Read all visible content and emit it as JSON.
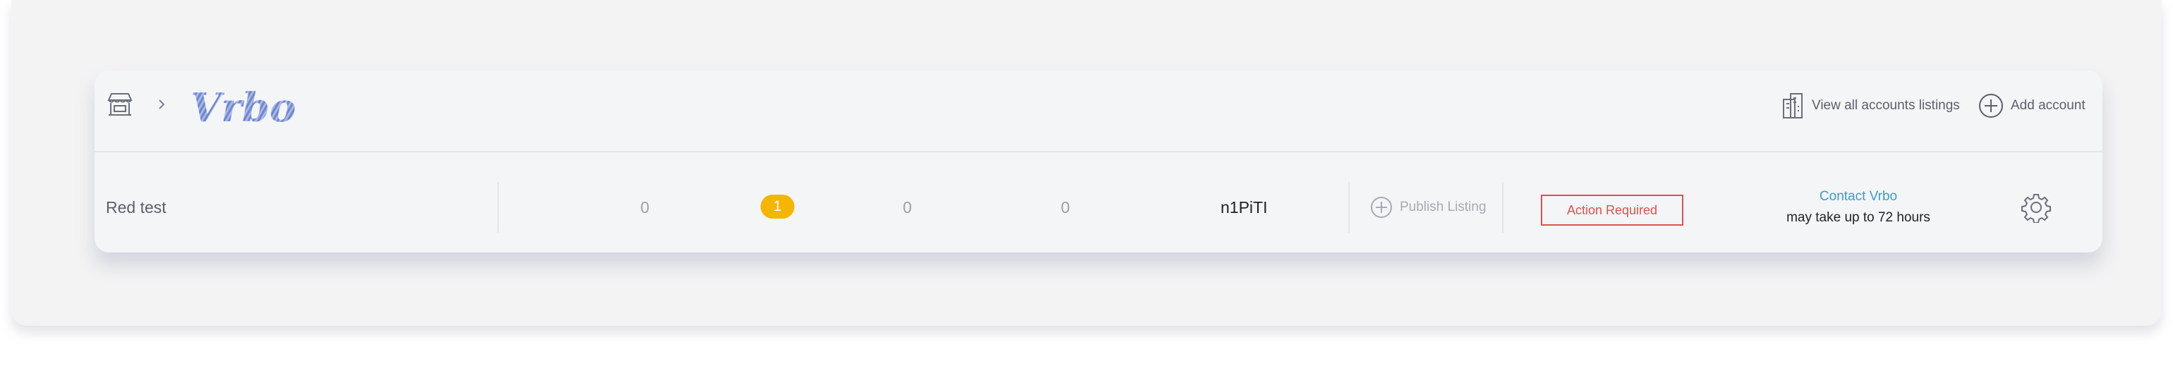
{
  "header": {
    "brand_name": "Vrbo",
    "view_all_label": "View all accounts listings",
    "add_account_label": "Add account"
  },
  "listing": {
    "name": "Red test",
    "counts": [
      "0",
      "1",
      "0",
      "0"
    ],
    "code": "n1PiTI",
    "publish_label": "Publish Listing",
    "status_label": "Action Required",
    "contact_label": "Contact Vrbo",
    "contact_note": "may take up to 72 hours"
  },
  "colors": {
    "badge": "#f5b500",
    "status": "#e0504a",
    "link": "#3b9bd6",
    "logo": "#6d86cf"
  },
  "icons": {
    "store": "store-icon",
    "breadcrumb": "chevron-right-icon",
    "building": "building-icon",
    "add": "plus-circle-icon",
    "settings": "gear-icon"
  }
}
